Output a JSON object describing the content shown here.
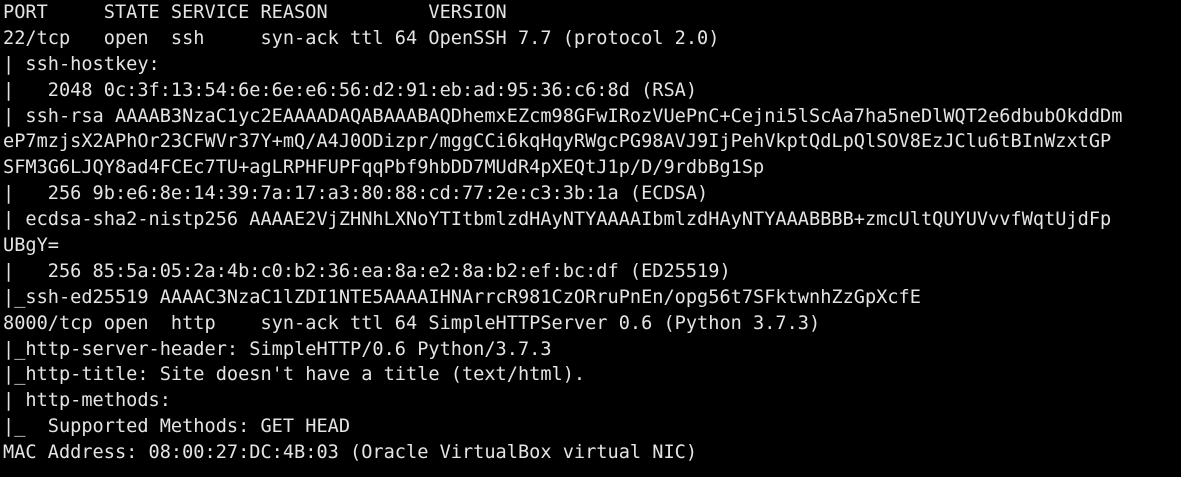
{
  "terminal": {
    "colors": {
      "background": "#000000",
      "foreground": "#e4e4e4"
    },
    "lines": [
      "PORT     STATE SERVICE REASON         VERSION",
      "22/tcp   open  ssh     syn-ack ttl 64 OpenSSH 7.7 (protocol 2.0)",
      "| ssh-hostkey:",
      "|   2048 0c:3f:13:54:6e:6e:e6:56:d2:91:eb:ad:95:36:c6:8d (RSA)",
      "| ssh-rsa AAAAB3NzaC1yc2EAAAADAQABAAABAQDhemxEZcm98GFwIRozVUePnC+Cejni5lScAa7ha5neDlWQT2e6dbubOkddDm",
      "eP7mzjsX2APhOr23CFWVr37Y+mQ/A4J0ODizpr/mggCCi6kqHqyRWgcPG98AVJ9IjPehVkptQdLpQlSOV8EzJClu6tBInWzxtGP",
      "SFM3G6LJQY8ad4FCEc7TU+agLRPHFUPFqqPbf9hbDD7MUdR4pXEQtJ1p/D/9rdbBg1Sp",
      "|   256 9b:e6:8e:14:39:7a:17:a3:80:88:cd:77:2e:c3:3b:1a (ECDSA)",
      "| ecdsa-sha2-nistp256 AAAAE2VjZHNhLXNoYTItbmlzdHAyNTYAAAAIbmlzdHAyNTYAAABBBB+zmcUltQUYUVvvfWqtUjdFp",
      "UBgY=",
      "|   256 85:5a:05:2a:4b:c0:b2:36:ea:8a:e2:8a:b2:ef:bc:df (ED25519)",
      "|_ssh-ed25519 AAAAC3NzaC1lZDI1NTE5AAAAIHNArrcR981CzORruPnEn/opg56t7SFktwnhZzGpXcfE",
      "8000/tcp open  http    syn-ack ttl 64 SimpleHTTPServer 0.6 (Python 3.7.3)",
      "|_http-server-header: SimpleHTTP/0.6 Python/3.7.3",
      "|_http-title: Site doesn't have a title (text/html).",
      "| http-methods:",
      "|_  Supported Methods: GET HEAD",
      "MAC Address: 08:00:27:DC:4B:03 (Oracle VirtualBox virtual NIC)"
    ]
  }
}
